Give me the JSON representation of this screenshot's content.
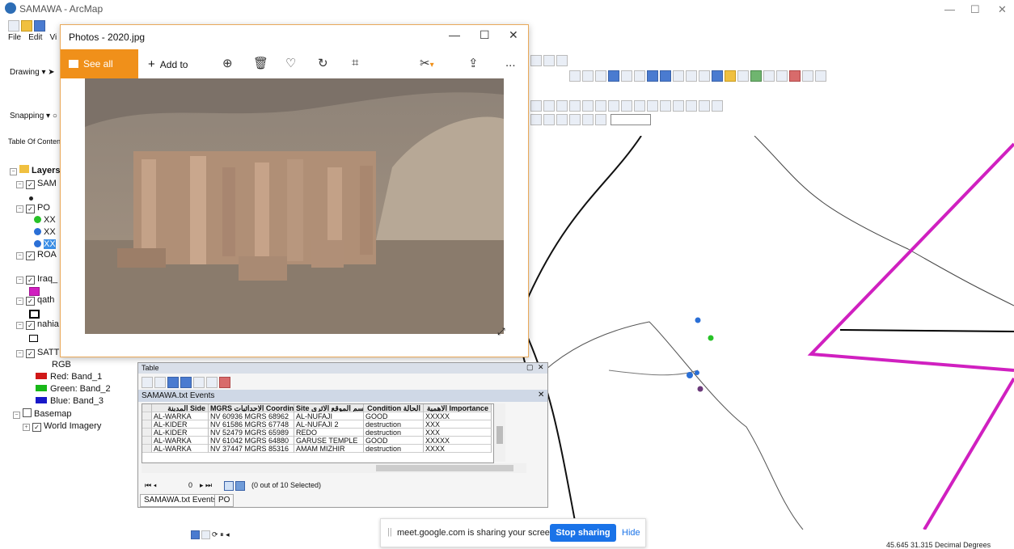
{
  "arcmap": {
    "title": "SAMAWA - ArcMap",
    "menu": [
      "File",
      "Edit",
      "Vi"
    ],
    "drawing_label": "Drawing",
    "snapping_label": "Snapping",
    "toc_title": "Table Of Content"
  },
  "toc": {
    "root": "Layers",
    "layers": [
      {
        "name": "SAM",
        "checked": true
      },
      {
        "name": "PO",
        "checked": true,
        "items": [
          "XX",
          "XX",
          "XX"
        ]
      },
      {
        "name": "ROA",
        "checked": true
      },
      {
        "name": "Iraq_",
        "checked": true
      },
      {
        "name": "qath",
        "checked": true
      },
      {
        "name": "nahia",
        "checked": true
      },
      {
        "name": "SATT",
        "checked": true
      }
    ],
    "raster": {
      "label": "RGB",
      "bands": [
        "Red:  Band_1",
        "Green: Band_2",
        "Blue:  Band_3"
      ]
    },
    "basemap": {
      "name": "Basemap",
      "child": "World Imagery"
    }
  },
  "photos": {
    "title": "Photos - 2020.jpg",
    "see_all": "See all photos",
    "add_to": "Add to",
    "more": "...",
    "controls": {
      "minimize": "—",
      "maximize": "☐",
      "close": "✕"
    }
  },
  "table": {
    "title": "Table",
    "subtitle": "SAMAWA.txt Events",
    "columns": [
      "المدينة Side",
      "MGRS الاحداثيات Coordinate",
      "Site اسم الموقع الاثري",
      "Condition الحالة",
      "الاهمية Importance"
    ],
    "rows": [
      [
        "AL-WARKA",
        "NV 60936 MGRS 68962",
        "AL-NUFAJI",
        "GOOD",
        "XXXXX"
      ],
      [
        "AL-KIDER",
        "NV 61586 MGRS 67748",
        "AL-NUFAJI 2",
        "destruction",
        "XXX"
      ],
      [
        "AL-KIDER",
        "NV 52479 MGRS 65989",
        "REDO",
        "destruction",
        "XXX"
      ],
      [
        "AL-WARKA",
        "NV 61042 MGRS 64880",
        "GARUSE TEMPLE",
        "GOOD",
        "XXXXX"
      ],
      [
        "AL-WARKA",
        "NV 37447 MGRS 85316",
        "AMAM MIZHIR",
        "destruction",
        "XXXX"
      ]
    ],
    "nav_record": "0",
    "selection": "(0 out of 10 Selected)",
    "tabs": [
      "SAMAWA.txt Events",
      "PO"
    ]
  },
  "share": {
    "message": "meet.google.com is sharing your screen.",
    "stop": "Stop sharing",
    "hide": "Hide"
  },
  "status": {
    "coords": "45.645  31.315 Decimal Degrees"
  },
  "colors": {
    "accent": "#f0901a",
    "share_blue": "#1a73e8",
    "boundary": "#d020c0"
  }
}
